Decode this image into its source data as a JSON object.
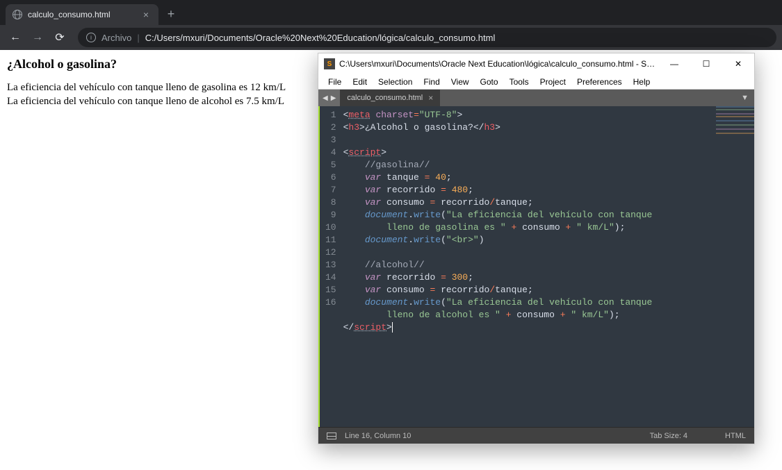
{
  "browser": {
    "tab_title": "calculo_consumo.html",
    "url_label": "Archivo",
    "url": "C:/Users/mxuri/Documents/Oracle%20Next%20Education/lógica/calculo_consumo.html"
  },
  "page": {
    "heading": "¿Alcohol o gasolina?",
    "line1": "La eficiencia del vehículo con tanque lleno de gasolina es 12 km/L",
    "line2": "La eficiencia del vehículo con tanque lleno de alcohol es 7.5 km/L"
  },
  "sublime": {
    "title": "C:\\Users\\mxuri\\Documents\\Oracle Next Education\\lógica\\calculo_consumo.html - Sub...",
    "menu": [
      "File",
      "Edit",
      "Selection",
      "Find",
      "View",
      "Goto",
      "Tools",
      "Project",
      "Preferences",
      "Help"
    ],
    "tab": "calculo_consumo.html",
    "status_left": "Line 16, Column 10",
    "status_tab": "Tab Size: 4",
    "status_lang": "HTML",
    "gutter": [
      "1",
      "2",
      "3",
      "4",
      "5",
      "6",
      "7",
      "8",
      "9",
      "10",
      "11",
      "12",
      "13",
      "14",
      "15",
      "16"
    ],
    "code": {
      "l1_meta": "meta",
      "l1_charset": "charset",
      "l1_val": "\"UTF-8\"",
      "l2_h3o": "h3",
      "l2_text": "¿Alcohol o gasolina?",
      "l2_h3c": "h3",
      "l4_script": "script",
      "l5_comment": "//gasolina//",
      "l6_var": "var",
      "l6_name": "tanque",
      "l6_eq": "=",
      "l6_val": "40",
      "l7_var": "var",
      "l7_name": "recorrido",
      "l7_eq": "=",
      "l7_val": "480",
      "l8_var": "var",
      "l8_name": "consumo",
      "l8_eq": "=",
      "l8_a": "recorrido",
      "l8_op": "/",
      "l8_b": "tanque",
      "l9_obj": "document",
      "l9_fn": "write",
      "l9_str1": "\"La eficiencia del vehículo con tanque ",
      "l9b_str": "lleno de gasolina es \"",
      "l9b_plus1": "+",
      "l9b_var": "consumo",
      "l9b_plus2": "+",
      "l9b_str2": "\" km/L\"",
      "l10_obj": "document",
      "l10_fn": "write",
      "l10_str": "\"<br>\"",
      "l12_comment": "//alcohol//",
      "l13_var": "var",
      "l13_name": "recorrido",
      "l13_eq": "=",
      "l13_val": "300",
      "l14_var": "var",
      "l14_name": "consumo",
      "l14_eq": "=",
      "l14_a": "recorrido",
      "l14_op": "/",
      "l14_b": "tanque",
      "l15_obj": "document",
      "l15_fn": "write",
      "l15_str1": "\"La eficiencia del vehículo con tanque ",
      "l15b_str": "lleno de alcohol es \"",
      "l15b_plus1": "+",
      "l15b_var": "consumo",
      "l15b_plus2": "+",
      "l15b_str2": "\" km/L\"",
      "l16_script": "script"
    }
  }
}
